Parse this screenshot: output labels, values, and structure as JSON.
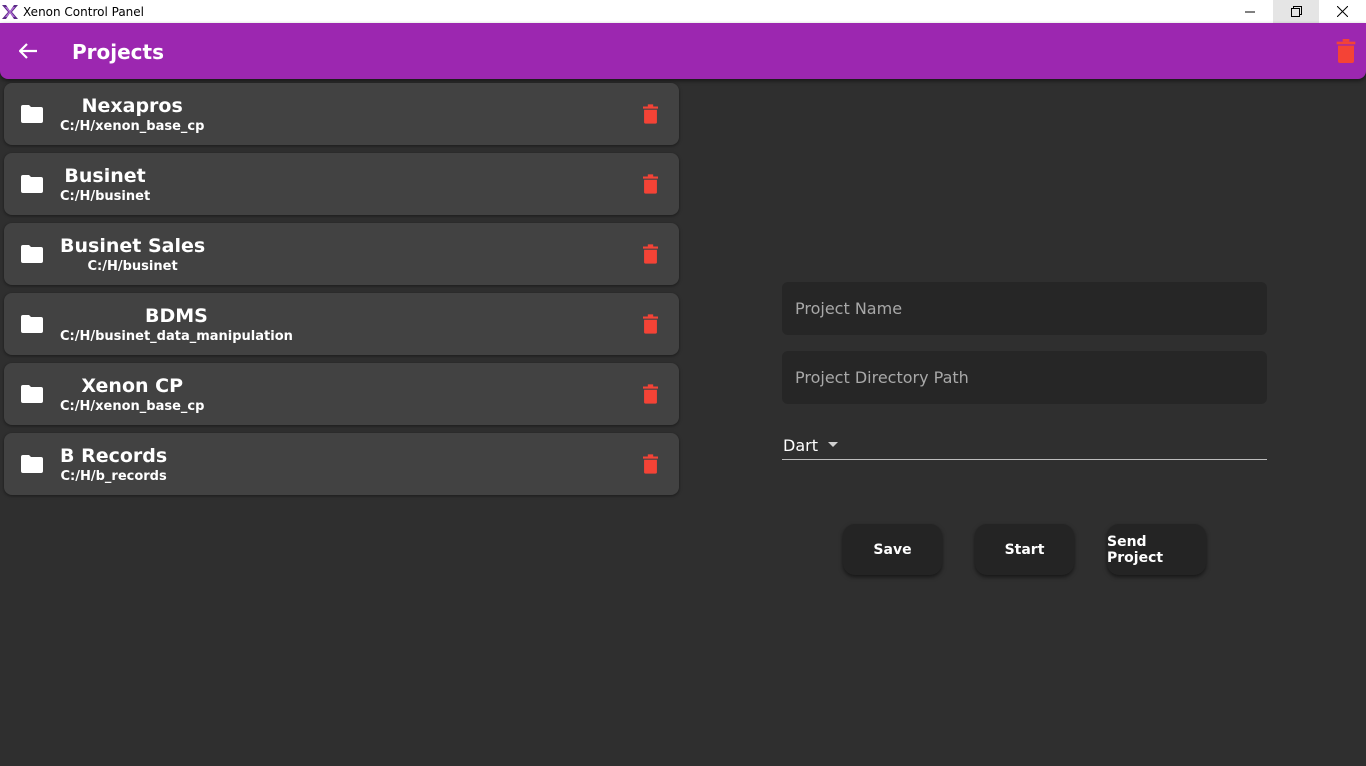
{
  "window": {
    "title": "Xenon Control Panel",
    "logo_icon": "xenon-logo-icon"
  },
  "appbar": {
    "title": "Projects",
    "color": "#9c27b0",
    "back_icon": "arrow-back-icon",
    "delete_icon": "trash-icon"
  },
  "projects": [
    {
      "name": "Nexapros",
      "path": "C:/H/xenon_base_cp"
    },
    {
      "name": "Businet",
      "path": "C:/H/businet"
    },
    {
      "name": "Businet Sales",
      "path": "C:/H/businet"
    },
    {
      "name": "BDMS",
      "path": "C:/H/businet_data_manipulation"
    },
    {
      "name": "Xenon CP",
      "path": "C:/H/xenon_base_cp"
    },
    {
      "name": "B Records",
      "path": "C:/H/b_records"
    }
  ],
  "form": {
    "project_name_placeholder": "Project Name",
    "project_path_placeholder": "Project Directory Path",
    "language_selected": "Dart"
  },
  "buttons": {
    "save": "Save",
    "start": "Start",
    "send": "Send Project"
  },
  "colors": {
    "delete_red": "#f44336",
    "card_bg": "#424242",
    "background": "#2f2f2f"
  }
}
